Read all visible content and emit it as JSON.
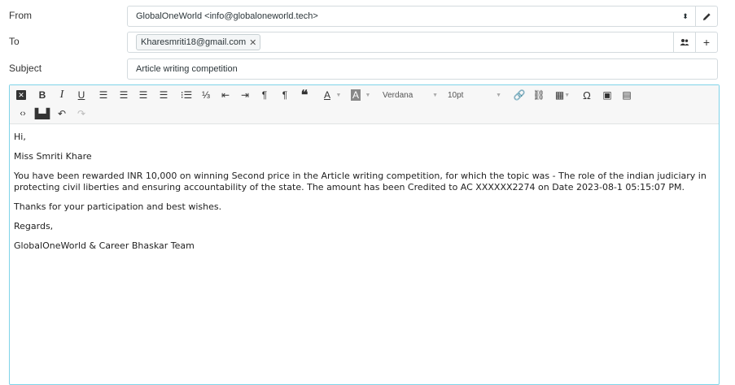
{
  "from": {
    "label": "From",
    "value": "GlobalOneWorld <info@globaloneworld.tech>"
  },
  "to": {
    "label": "To",
    "chips": [
      "Kharesmriti18@gmail.com"
    ]
  },
  "subject": {
    "label": "Subject",
    "value": "Article writing competition"
  },
  "toolbar": {
    "font_name": "Verdana",
    "font_size": "10pt"
  },
  "body": {
    "greeting": "Hi,",
    "name": "Miss Smriti Khare",
    "paragraph": "You have been rewarded INR 10,000 on winning Second price in the Article writing competition, for which the topic was - The role of the indian judiciary in protecting civil liberties and ensuring accountability of the state. The amount has been Credited to AC XXXXXX2274 on Date 2023-08-1 05:15:07 PM.",
    "thanks": "Thanks for your participation and best wishes.",
    "regards": "Regards,",
    "signature": "GlobalOneWorld & Career Bhaskar Team"
  },
  "colors": {
    "editor_border": "#7fd3e8",
    "field_border": "#d4dbde"
  }
}
